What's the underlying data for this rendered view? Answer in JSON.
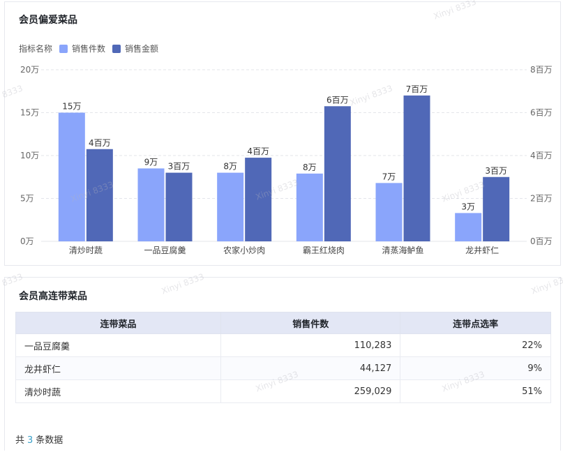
{
  "top_card": {
    "title": "会员偏爱菜品",
    "legend_label": "指标名称"
  },
  "chart_data": {
    "type": "bar",
    "categories": [
      "清炒时蔬",
      "一品豆腐羹",
      "农家小炒肉",
      "霸王红烧肉",
      "清蒸海鲈鱼",
      "龙井虾仁"
    ],
    "series": [
      {
        "name": "销售件数",
        "axis": "left",
        "values": [
          150000,
          85000,
          80000,
          79000,
          68000,
          33000
        ],
        "labels": [
          "15万",
          "9万",
          "8万",
          "8万",
          "7万",
          "3万"
        ],
        "color": "#8aa5fb"
      },
      {
        "name": "销售金额",
        "axis": "right",
        "values": [
          4300000,
          3200000,
          3900000,
          6300000,
          6800000,
          3000000
        ],
        "labels": [
          "4百万",
          "3百万",
          "4百万",
          "6百万",
          "7百万",
          "3百万"
        ],
        "color": "#5068b7"
      }
    ],
    "y_left": {
      "ylim": [
        0,
        200000
      ],
      "ticks": [
        "0万",
        "5万",
        "10万",
        "15万",
        "20万"
      ]
    },
    "y_right": {
      "ylim": [
        0,
        8000000
      ],
      "ticks": [
        "0百万",
        "2百万",
        "4百万",
        "6百万",
        "8百万"
      ]
    },
    "grid": true,
    "legend_position": "top-left"
  },
  "bottom_card": {
    "title": "会员高连带菜品",
    "columns": [
      "连带菜品",
      "销售件数",
      "连带点选率"
    ],
    "rows": [
      [
        "一品豆腐羹",
        "110,283",
        "22%"
      ],
      [
        "龙井虾仁",
        "44,127",
        "9%"
      ],
      [
        "清炒时蔬",
        "259,029",
        "51%"
      ]
    ],
    "footer_prefix": "共",
    "footer_count": "3",
    "footer_suffix": "条数据"
  },
  "watermark": "Xinyi 8333"
}
